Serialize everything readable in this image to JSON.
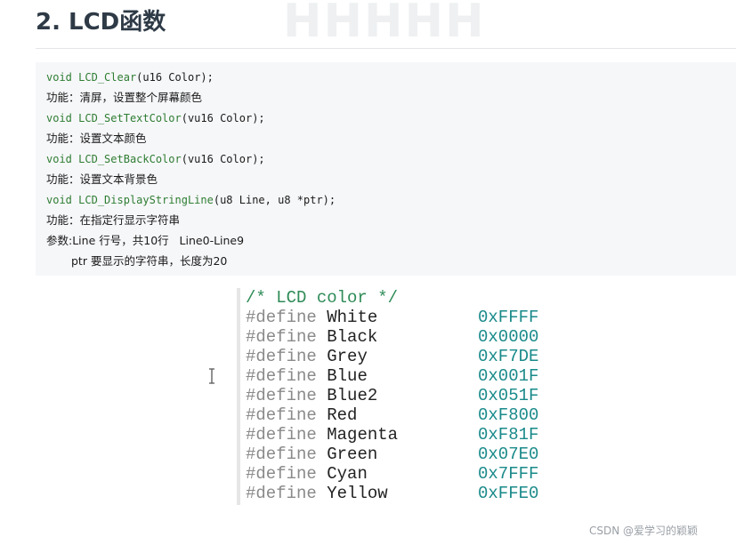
{
  "heading": {
    "title": "2. LCD函数"
  },
  "code": {
    "lines": [
      {
        "kw": "void",
        "fn": "LCD_Clear",
        "args": "(u16 Color);"
      },
      {
        "text": "功能：清屏，设置整个屏幕颜色"
      },
      {
        "kw": "void",
        "fn": "LCD_SetTextColor",
        "args": "(vu16 Color);"
      },
      {
        "text": "功能：设置文本颜色"
      },
      {
        "kw": "void",
        "fn": "LCD_SetBackColor",
        "args": "(vu16 Color);"
      },
      {
        "text": "功能：设置文本背景色"
      },
      {
        "kw": "void",
        "fn": "LCD_DisplayStringLine",
        "args": "(u8 Line, u8 *ptr);"
      },
      {
        "text": "功能：在指定行显示字符串"
      },
      {
        "text": "参数:Line 行号，共10行   Line0-Line9"
      },
      {
        "text": "ptr 要显示的字符串，长度为20"
      }
    ]
  },
  "colors_image": {
    "comment": "/* LCD color */",
    "keyword": "#define",
    "defines": [
      {
        "name": "White",
        "value": "0xFFFF"
      },
      {
        "name": "Black",
        "value": "0x0000"
      },
      {
        "name": "Grey",
        "value": "0xF7DE"
      },
      {
        "name": "Blue",
        "value": "0x001F"
      },
      {
        "name": "Blue2",
        "value": "0x051F"
      },
      {
        "name": "Red",
        "value": "0xF800"
      },
      {
        "name": "Magenta",
        "value": "0xF81F"
      },
      {
        "name": "Green",
        "value": "0x07E0"
      },
      {
        "name": "Cyan",
        "value": "0x7FFF"
      },
      {
        "name": "Yellow",
        "value": "0xFFE0"
      }
    ]
  },
  "cursor": {
    "icon": "text-cursor-icon"
  },
  "watermark": {
    "text": "CSDN @爱学习的颖颖"
  },
  "theme": {
    "keyword_color": "#2e7d32",
    "value_color": "#1a8a8a",
    "code_bg": "#f6f7f9"
  }
}
